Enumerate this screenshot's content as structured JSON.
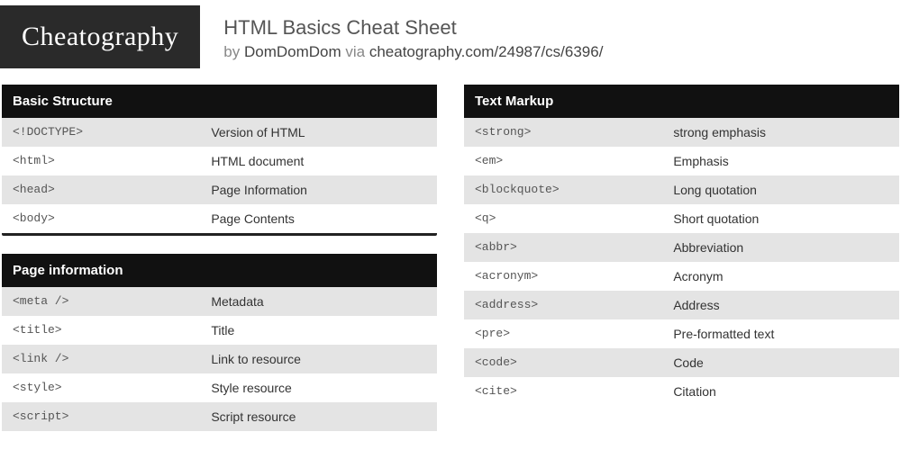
{
  "header": {
    "logo": "Cheatography",
    "title": "HTML Basics Cheat Sheet",
    "by_label": "by ",
    "author": "DomDomDom",
    "via_label": " via ",
    "url": "cheatography.com/24987/cs/6396/"
  },
  "sections": {
    "basic_structure": {
      "title": "Basic Structure",
      "rows": [
        {
          "tag": "<!DOCTYPE>",
          "desc": "Version of HTML"
        },
        {
          "tag": "<html>",
          "desc": "HTML document"
        },
        {
          "tag": "<head>",
          "desc": "Page Information"
        },
        {
          "tag": "<body>",
          "desc": "Page Contents"
        }
      ]
    },
    "page_information": {
      "title": "Page information",
      "rows": [
        {
          "tag": "<meta />",
          "desc": "Metadata"
        },
        {
          "tag": "<title>",
          "desc": "Title"
        },
        {
          "tag": "<link />",
          "desc": "Link to resource"
        },
        {
          "tag": "<style>",
          "desc": "Style resource"
        },
        {
          "tag": "<script>",
          "desc": "Script resource"
        }
      ]
    },
    "text_markup": {
      "title": "Text Markup",
      "rows": [
        {
          "tag": "<strong>",
          "desc": "strong emphasis"
        },
        {
          "tag": "<em>",
          "desc": "Emphasis"
        },
        {
          "tag": "<blockquote>",
          "desc": "Long quotation"
        },
        {
          "tag": "<q>",
          "desc": "Short quotation"
        },
        {
          "tag": "<abbr>",
          "desc": "Abbreviation"
        },
        {
          "tag": "<acronym>",
          "desc": "Acronym"
        },
        {
          "tag": "<address>",
          "desc": "Address"
        },
        {
          "tag": "<pre>",
          "desc": "Pre-formatted text"
        },
        {
          "tag": "<code>",
          "desc": "Code"
        },
        {
          "tag": "<cite>",
          "desc": "Citation"
        }
      ]
    }
  }
}
